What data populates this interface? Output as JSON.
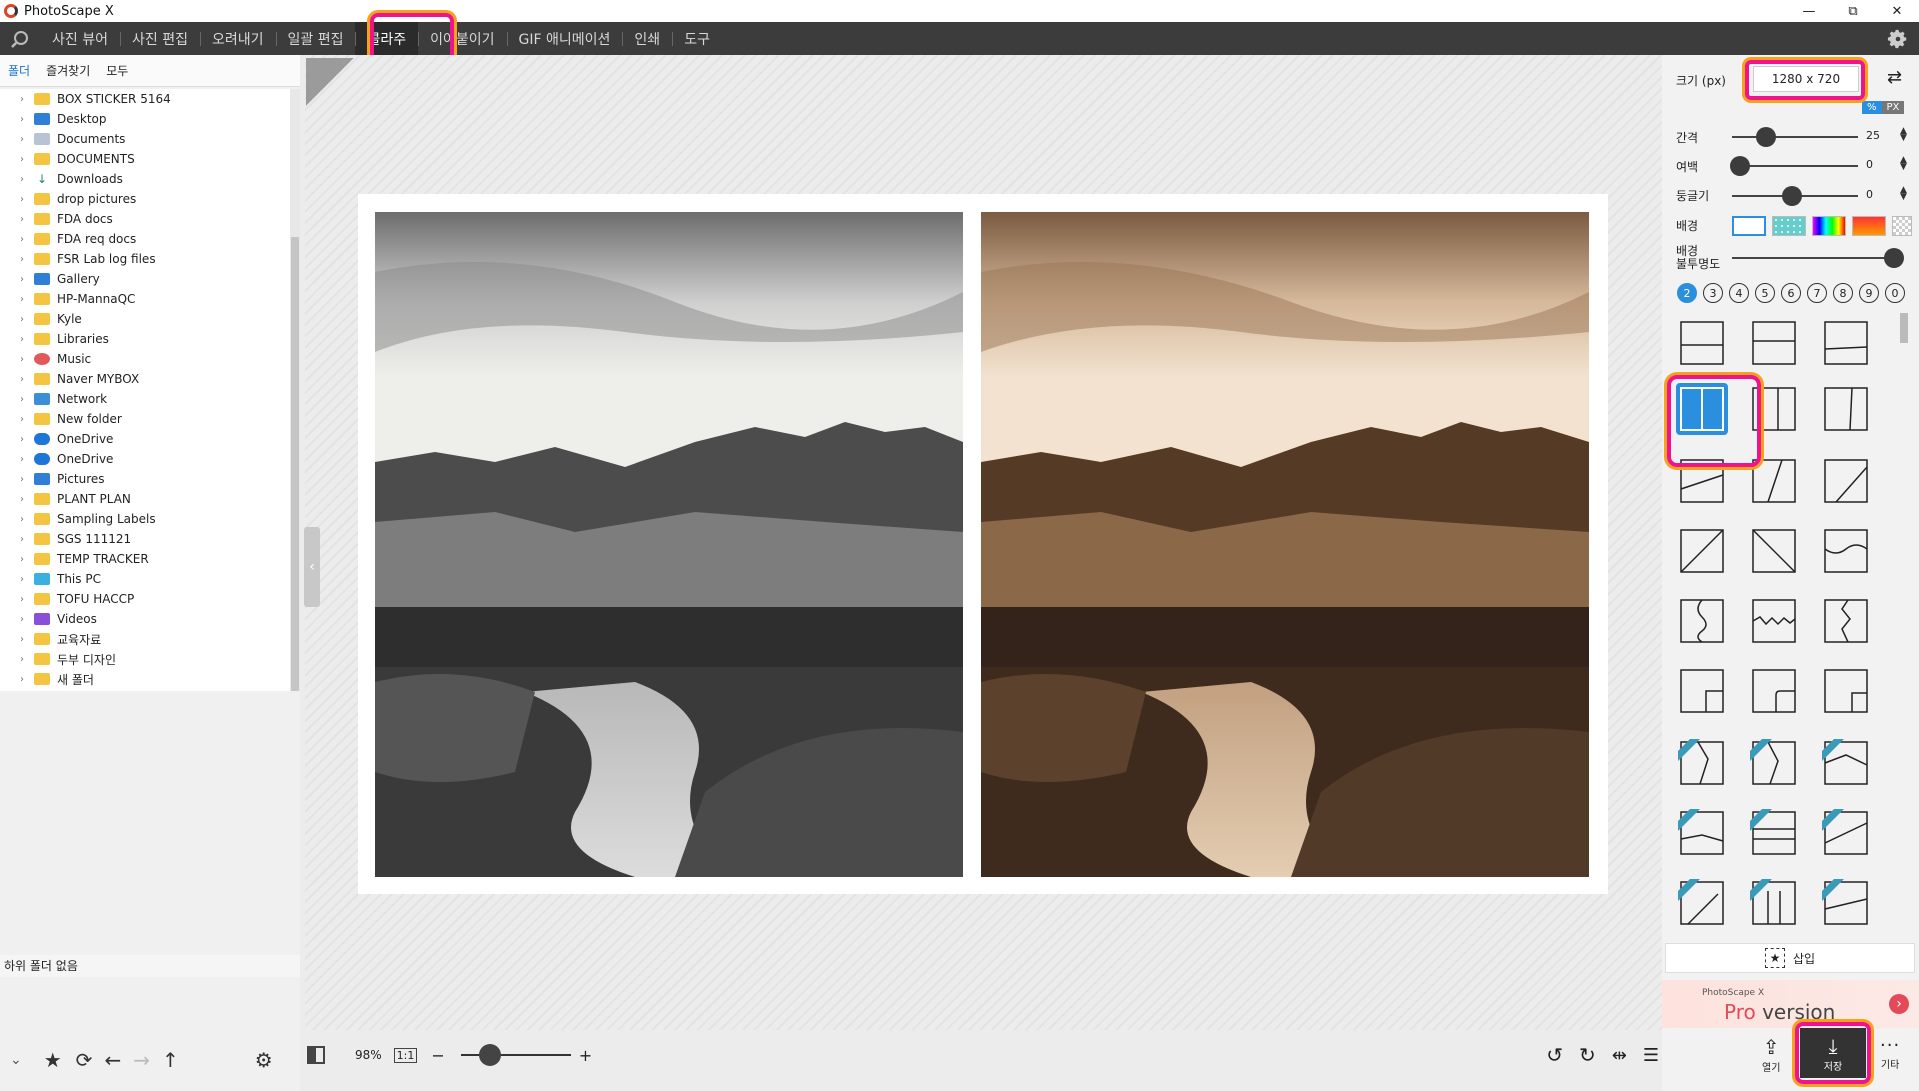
{
  "app": {
    "title": "PhotoScape X"
  },
  "window_controls": {
    "minimize": "—",
    "maximize": "⧉",
    "close": "✕"
  },
  "tabs": [
    {
      "label": "사진 뷰어"
    },
    {
      "label": "사진 편집"
    },
    {
      "label": "오려내기"
    },
    {
      "label": "일괄 편집"
    },
    {
      "label": "콜라주"
    },
    {
      "label": "이어붙이기"
    },
    {
      "label": "GIF 애니메이션"
    },
    {
      "label": "인쇄"
    },
    {
      "label": "도구"
    }
  ],
  "active_tab": "콜라주",
  "left_panel": {
    "subtabs": [
      "폴더",
      "즐겨찾기",
      "모두"
    ],
    "folders": [
      "BOX STICKER 5164",
      "Desktop",
      "Documents",
      "DOCUMENTS",
      "Downloads",
      "drop pictures",
      "FDA docs",
      "FDA req docs",
      "FSR Lab log files",
      "Gallery",
      "HP-MannaQC",
      "Kyle",
      "Libraries",
      "Music",
      "Naver MYBOX",
      "Network",
      "New folder",
      "OneDrive",
      "OneDrive",
      "Pictures",
      "PLANT PLAN",
      "Sampling Labels",
      "SGS 111121",
      "TEMP TRACKER",
      "This PC",
      "TOFU HACCP",
      "Videos",
      "교육자료",
      "두부 디자인",
      "새 폴더"
    ],
    "status": "하위 폴더 없음"
  },
  "bottom_toolbar": {
    "zoom": "98%",
    "one_to_one": "1:1"
  },
  "right_panel": {
    "size_label": "크기 (px)",
    "size_value": "1280 x 720",
    "unit_percent": "%",
    "unit_px": "PX",
    "spacing_label": "간격",
    "spacing_value": "25",
    "margin_label": "여백",
    "margin_value": "0",
    "round_label": "둥글기",
    "round_value": "0",
    "bg_label": "배경",
    "bg_opacity_label_1": "배경",
    "bg_opacity_label_2": "불투명도",
    "photo_counts": [
      "2",
      "3",
      "4",
      "5",
      "6",
      "7",
      "8",
      "9",
      "0"
    ],
    "insert_label": "삽입",
    "pro_small": "PhotoScape X",
    "pro_big": "Pro",
    "pro_version": "version",
    "open_label": "열기",
    "save_label": "저장",
    "more_label": "기타"
  }
}
